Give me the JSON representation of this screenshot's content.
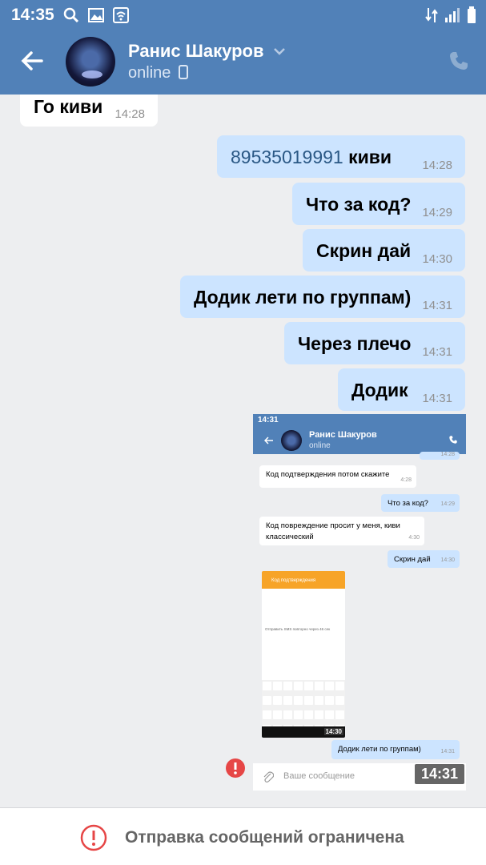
{
  "status_bar": {
    "time": "14:35"
  },
  "header": {
    "name": "Ранис Шакуров",
    "status": "online"
  },
  "messages": [
    {
      "dir": "in",
      "text": "Го киви",
      "time": "14:28"
    },
    {
      "dir": "out",
      "number": "89535019991",
      "text": " киви",
      "time": "14:28"
    },
    {
      "dir": "out",
      "text": "Что за код?",
      "time": "14:29"
    },
    {
      "dir": "out",
      "text": "Скрин дай",
      "time": "14:30"
    },
    {
      "dir": "out",
      "text": "Додик лети по группам)",
      "time": "14:31"
    },
    {
      "dir": "out",
      "text": "Через плечо",
      "time": "14:31"
    },
    {
      "dir": "out",
      "text": "Додик",
      "time": "14:31"
    }
  ],
  "screenshot": {
    "time": "14:31",
    "name": "Ранис Шакуров",
    "status": "online",
    "top_time": "14:28",
    "messages": [
      {
        "dir": "in",
        "text": "Код подтверждения потом скажите",
        "time": "4:28"
      },
      {
        "dir": "out",
        "text": "Что за код?",
        "time": "14:29"
      },
      {
        "dir": "in",
        "line1": "Код повреждение просит у меня, киви",
        "line2": "классический",
        "time": "4:30"
      },
      {
        "dir": "out",
        "text": "Скрин дай",
        "time": "14:30"
      },
      {
        "dir": "out",
        "text": "Додик лети по группам)",
        "time": "14:31"
      }
    ],
    "inner_image": {
      "title": "Код подтверждения",
      "line": "Отправить SMS повторно через 46 сек",
      "time": "14:30"
    },
    "input_placeholder": "Ваше сообщение",
    "overlay_time": "14:31"
  },
  "footer": {
    "text": "Отправка сообщений ограничена"
  },
  "colors": {
    "header": "#5181b8",
    "outgoing": "#cce4ff",
    "incoming": "#ffffff",
    "error": "#e64646"
  }
}
